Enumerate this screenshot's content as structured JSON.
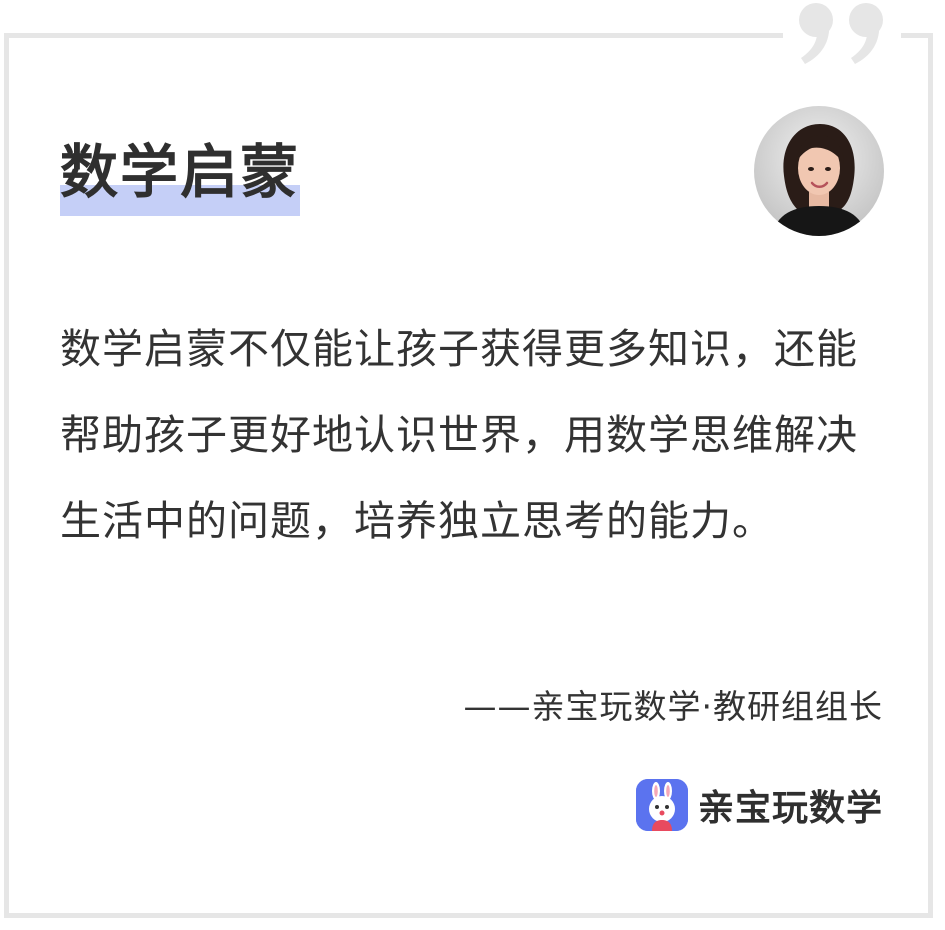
{
  "card": {
    "title": "数学启蒙",
    "body": "数学启蒙不仅能让孩子获得更多知识，还能帮助孩子更好地认识世界，用数学思维解决生活中的问题，培养独立思考的能力。",
    "attribution": "——亲宝玩数学·教研组组长"
  },
  "brand": {
    "name": "亲宝玩数学"
  },
  "icons": {
    "quote": "closing-quote-icon",
    "avatar": "author-avatar",
    "logo": "rabbit-mascot-logo"
  },
  "colors": {
    "highlight": "#c5cff7",
    "frame": "#e6e6e6",
    "quote": "#e6e6e6",
    "text": "#333333",
    "logo_bg": "#5b73ef"
  }
}
